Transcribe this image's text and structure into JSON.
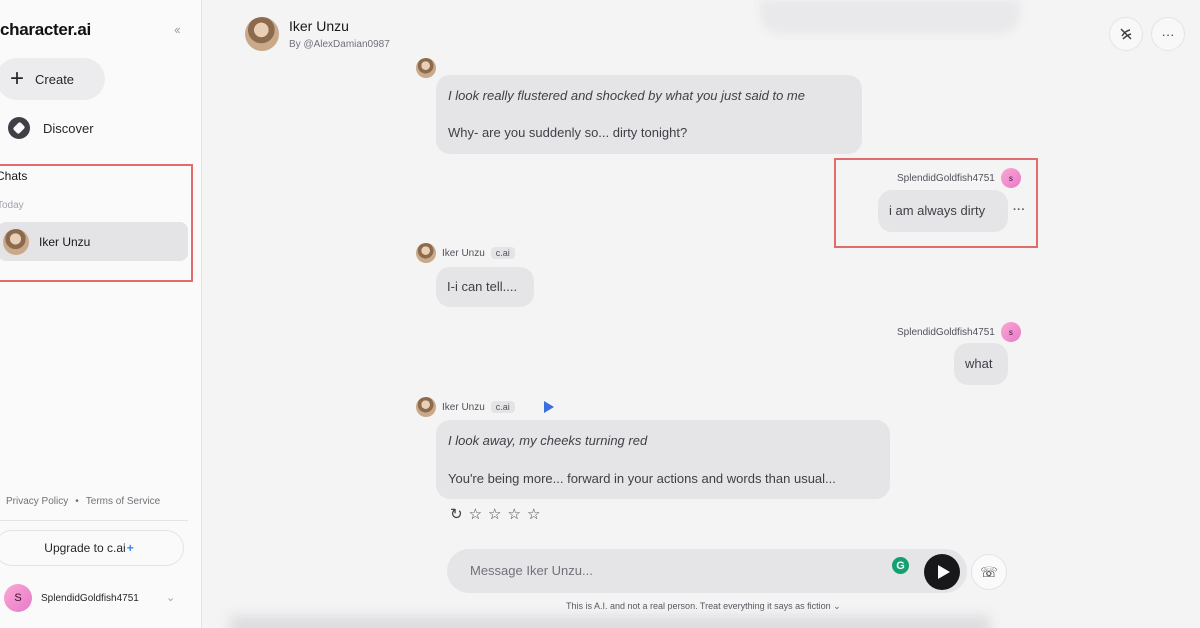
{
  "app": {
    "logo": "character.ai",
    "collapse_icon": "chevrons-left-icon"
  },
  "sidebar": {
    "create_label": "Create",
    "discover_label": "Discover",
    "chats_title": "Chats",
    "today_label": "Today",
    "chat_items": [
      {
        "name": "Iker Unzu"
      }
    ],
    "privacy_link": "Privacy Policy",
    "separator": "•",
    "terms_link": "Terms of Service",
    "upgrade_label": "Upgrade to c.ai",
    "upgrade_plus": "+",
    "user": {
      "initial": "S",
      "name": "SplendidGoldfish4751"
    }
  },
  "header": {
    "name": "Iker Unzu",
    "byline": "By @AlexDamian0987",
    "mute_icon": "voice-off-icon",
    "more_label": "···"
  },
  "messages": [
    {
      "author": "Iker Unzu",
      "tag": "c.ai",
      "action": "I look really flustered and shocked by what you just said to me",
      "text": "Why- are you suddenly so... dirty tonight?"
    },
    {
      "author": "SplendidGoldfish4751",
      "initial": "s",
      "text": "i am always dirty",
      "more": "···"
    },
    {
      "author": "Iker Unzu",
      "tag": "c.ai",
      "text": "I-i can tell...."
    },
    {
      "author": "SplendidGoldfish4751",
      "initial": "s",
      "text": "what"
    },
    {
      "author": "Iker Unzu",
      "tag": "c.ai",
      "action": "I look away, my cheeks turning red",
      "text": "You're being more... forward in your actions and words than usual..."
    }
  ],
  "rating": {
    "regenerate": "↻",
    "stars": [
      "☆",
      "☆",
      "☆",
      "☆"
    ]
  },
  "composer": {
    "placeholder": "Message Iker Unzu...",
    "grammarly": "G",
    "call_icon": "☏"
  },
  "disclaimer": "This is A.I. and not a real person. Treat everything it says as fiction",
  "disclaimer_chevron": "⌄",
  "colors": {
    "highlight": "#e26b6b",
    "accent": "#3b6fe0",
    "send": "#18181b"
  }
}
